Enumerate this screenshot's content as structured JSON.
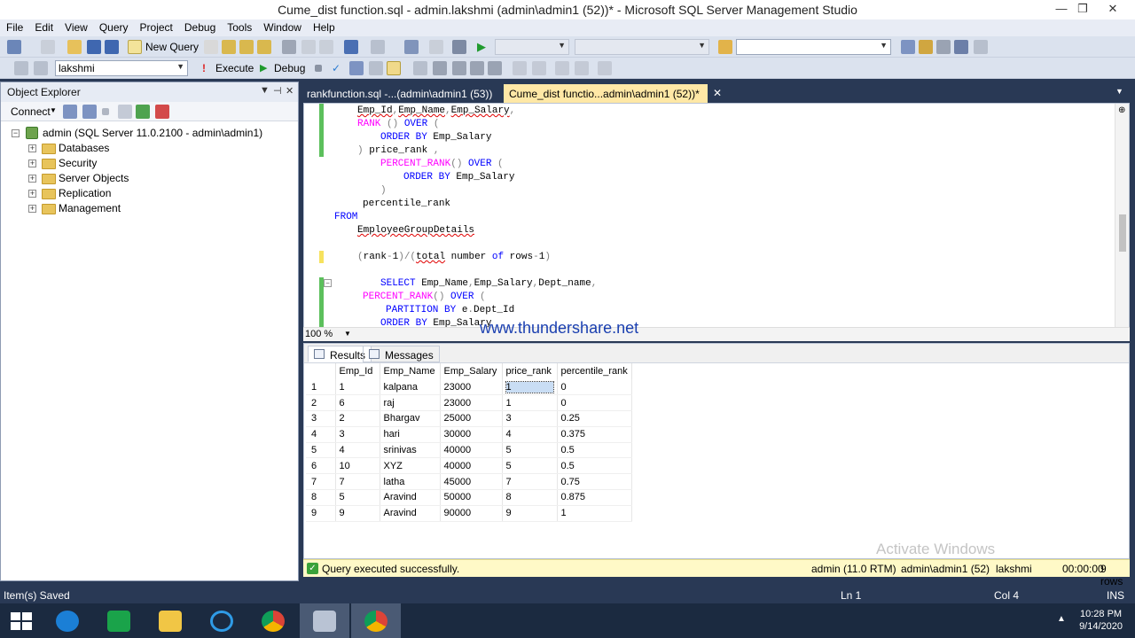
{
  "window": {
    "title": "Cume_dist function.sql - admin.lakshmi (admin\\admin1 (52))* - Microsoft SQL Server Management Studio",
    "min": "—",
    "max": "❐",
    "close": "✕"
  },
  "menu": [
    "File",
    "Edit",
    "View",
    "Query",
    "Project",
    "Debug",
    "Tools",
    "Window",
    "Help"
  ],
  "toolbar1": {
    "new_query": "New Query"
  },
  "toolbar2": {
    "database": "lakshmi",
    "execute": "Execute",
    "debug": "Debug"
  },
  "object_explorer": {
    "title": "Object Explorer",
    "connect": "Connect",
    "server": "admin (SQL Server 11.0.2100 - admin\\admin1)",
    "folders": [
      "Databases",
      "Security",
      "Server Objects",
      "Replication",
      "Management"
    ]
  },
  "tabs": {
    "inactive": "rankfunction.sql -...(admin\\admin1 (53))",
    "active": "Cume_dist functio...admin\\admin1 (52))*",
    "close": "✕"
  },
  "editor": {
    "zoom": "100 %",
    "watermark": "www.thundershare.net"
  },
  "results": {
    "tab_results": "Results",
    "tab_messages": "Messages",
    "columns": [
      "Emp_Id",
      "Emp_Name",
      "Emp_Salary",
      "price_rank",
      "percentile_rank"
    ],
    "rows": [
      [
        "1",
        "1",
        "kalpana",
        "23000",
        "1",
        "0"
      ],
      [
        "2",
        "6",
        "raj",
        "23000",
        "1",
        "0"
      ],
      [
        "3",
        "2",
        "Bhargav",
        "25000",
        "3",
        "0.25"
      ],
      [
        "4",
        "3",
        "hari",
        "30000",
        "4",
        "0.375"
      ],
      [
        "5",
        "4",
        "srinivas",
        "40000",
        "5",
        "0.5"
      ],
      [
        "6",
        "10",
        "XYZ",
        "40000",
        "5",
        "0.5"
      ],
      [
        "7",
        "7",
        "latha",
        "45000",
        "7",
        "0.75"
      ],
      [
        "8",
        "5",
        "Aravind",
        "50000",
        "8",
        "0.875"
      ],
      [
        "9",
        "9",
        "Aravind",
        "90000",
        "9",
        "1"
      ]
    ]
  },
  "overlay": {
    "activate": "Activate Windows"
  },
  "query_status": {
    "message": "Query executed successfully.",
    "server": "admin (11.0 RTM)",
    "user": "admin\\admin1 (52)",
    "db": "lakshmi",
    "time": "00:00:00",
    "rows": "9 rows"
  },
  "statusbar": {
    "left": "Item(s) Saved",
    "ln": "Ln 1",
    "col": "Col 4",
    "ins": "INS"
  },
  "taskbar": {
    "time": "10:28 PM",
    "date": "9/14/2020"
  },
  "colors": {
    "accent": "#293955",
    "tab_active": "#ffe8a6",
    "status_ok": "#fff9c7"
  }
}
